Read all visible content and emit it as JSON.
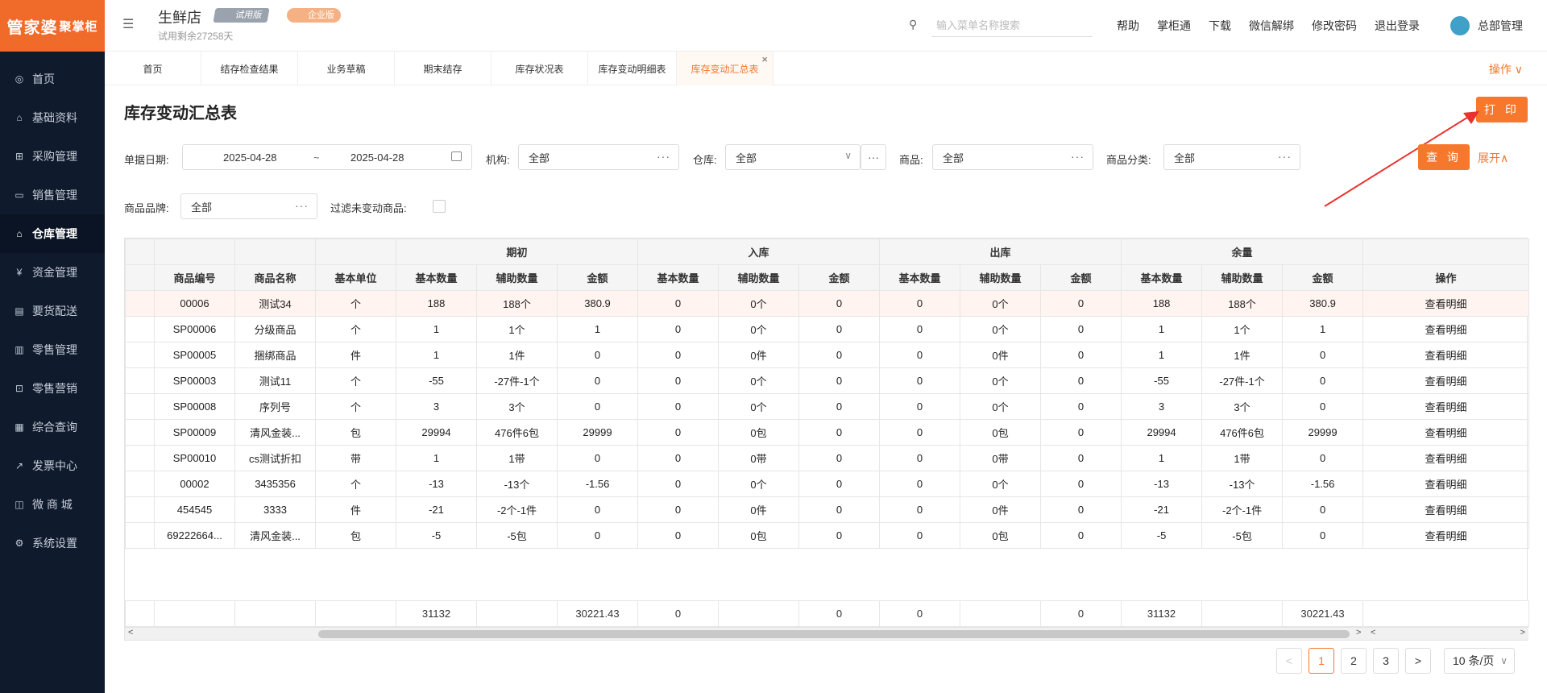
{
  "brand": {
    "logo_text": "管家婆",
    "logo_sub": "聚掌柜",
    "accent": "#f5782c",
    "sidebar_bg": "#0f1b2d"
  },
  "sidebar": {
    "items": [
      {
        "label": "首页",
        "icon": "globe-icon"
      },
      {
        "label": "基础资料",
        "icon": "home-icon"
      },
      {
        "label": "采购管理",
        "icon": "cart-icon"
      },
      {
        "label": "销售管理",
        "icon": "monitor-icon"
      },
      {
        "label": "仓库管理",
        "icon": "warehouse-icon"
      },
      {
        "label": "资金管理",
        "icon": "currency-icon"
      },
      {
        "label": "要货配送",
        "icon": "document-icon"
      },
      {
        "label": "零售管理",
        "icon": "bar-chart-icon"
      },
      {
        "label": "零售营销",
        "icon": "gift-icon"
      },
      {
        "label": "综合查询",
        "icon": "chart-icon"
      },
      {
        "label": "发票中心",
        "icon": "trend-icon"
      },
      {
        "label": "微 商 城",
        "icon": "bag-icon"
      },
      {
        "label": "系统设置",
        "icon": "gear-icon"
      }
    ],
    "active_index": 4
  },
  "header": {
    "store_name": "生鲜店",
    "badge_trial": "试用版",
    "badge_edition": "企业版",
    "trial_remaining": "试用剩余27258天",
    "search_placeholder": "输入菜单名称搜索",
    "links": [
      "帮助",
      "掌柜通",
      "下载",
      "微信解绑",
      "修改密码",
      "退出登录"
    ],
    "user_name": "总部管理"
  },
  "tabs": {
    "items": [
      "首页",
      "结存检查结果",
      "业务草稿",
      "期末结存",
      "库存状况表",
      "库存变动明细表",
      "库存变动汇总表"
    ],
    "active_index": 6,
    "operations_label": "操作 ∨"
  },
  "page": {
    "title": "库存变动汇总表",
    "print_label": "打 印",
    "query_label": "查 询",
    "expand_label": "展开∧"
  },
  "filters": {
    "date_label": "单据日期:",
    "date_from": "2025-04-28",
    "date_sep": "~",
    "date_to": "2025-04-28",
    "org_label": "机构:",
    "org_value": "全部",
    "warehouse_label": "仓库:",
    "warehouse_value": "全部",
    "product_label": "商品:",
    "product_value": "全部",
    "category_label": "商品分类:",
    "category_value": "全部",
    "brand_label": "商品品牌:",
    "brand_value": "全部",
    "filter_unchanged_label": "过滤未变动商品:"
  },
  "table": {
    "group_headers": [
      "期初",
      "入库",
      "出库",
      "余量"
    ],
    "columns": [
      "商品编号",
      "商品名称",
      "基本单位",
      "基本数量",
      "辅助数量",
      "金额",
      "基本数量",
      "辅助数量",
      "金额",
      "基本数量",
      "辅助数量",
      "金额",
      "基本数量",
      "辅助数量",
      "金额",
      "操作"
    ],
    "rows": [
      [
        "00006",
        "测试34",
        "个",
        "188",
        "188个",
        "380.9",
        "0",
        "0个",
        "0",
        "0",
        "0个",
        "0",
        "188",
        "188个",
        "380.9",
        "查看明细"
      ],
      [
        "SP00006",
        "分级商品",
        "个",
        "1",
        "1个",
        "1",
        "0",
        "0个",
        "0",
        "0",
        "0个",
        "0",
        "1",
        "1个",
        "1",
        "查看明细"
      ],
      [
        "SP00005",
        "捆绑商品",
        "件",
        "1",
        "1件",
        "0",
        "0",
        "0件",
        "0",
        "0",
        "0件",
        "0",
        "1",
        "1件",
        "0",
        "查看明细"
      ],
      [
        "SP00003",
        "测试11",
        "个",
        "-55",
        "-27件-1个",
        "0",
        "0",
        "0个",
        "0",
        "0",
        "0个",
        "0",
        "-55",
        "-27件-1个",
        "0",
        "查看明细"
      ],
      [
        "SP00008",
        "序列号",
        "个",
        "3",
        "3个",
        "0",
        "0",
        "0个",
        "0",
        "0",
        "0个",
        "0",
        "3",
        "3个",
        "0",
        "查看明细"
      ],
      [
        "SP00009",
        "清风金装...",
        "包",
        "29994",
        "476件6包",
        "29999",
        "0",
        "0包",
        "0",
        "0",
        "0包",
        "0",
        "29994",
        "476件6包",
        "29999",
        "查看明细"
      ],
      [
        "SP00010",
        "cs测试折扣",
        "带",
        "1",
        "1带",
        "0",
        "0",
        "0带",
        "0",
        "0",
        "0带",
        "0",
        "1",
        "1带",
        "0",
        "查看明细"
      ],
      [
        "00002",
        "3435356",
        "个",
        "-13",
        "-13个",
        "-1.56",
        "0",
        "0个",
        "0",
        "0",
        "0个",
        "0",
        "-13",
        "-13个",
        "-1.56",
        "查看明细"
      ],
      [
        "454545",
        "3333",
        "件",
        "-21",
        "-2个-1件",
        "0",
        "0",
        "0件",
        "0",
        "0",
        "0件",
        "0",
        "-21",
        "-2个-1件",
        "0",
        "查看明细"
      ],
      [
        "69222664...",
        "清风金装...",
        "包",
        "-5",
        "-5包",
        "0",
        "0",
        "0包",
        "0",
        "0",
        "0包",
        "0",
        "-5",
        "-5包",
        "0",
        "查看明细"
      ]
    ],
    "totals": [
      "",
      "",
      "",
      "31132",
      "",
      "30221.43",
      "0",
      "",
      "0",
      "0",
      "",
      "0",
      "31132",
      "",
      "30221.43",
      ""
    ]
  },
  "pagination": {
    "prev": "<",
    "pages": [
      "1",
      "2",
      "3"
    ],
    "current": "1",
    "next": ">",
    "page_size": "10 条/页"
  }
}
